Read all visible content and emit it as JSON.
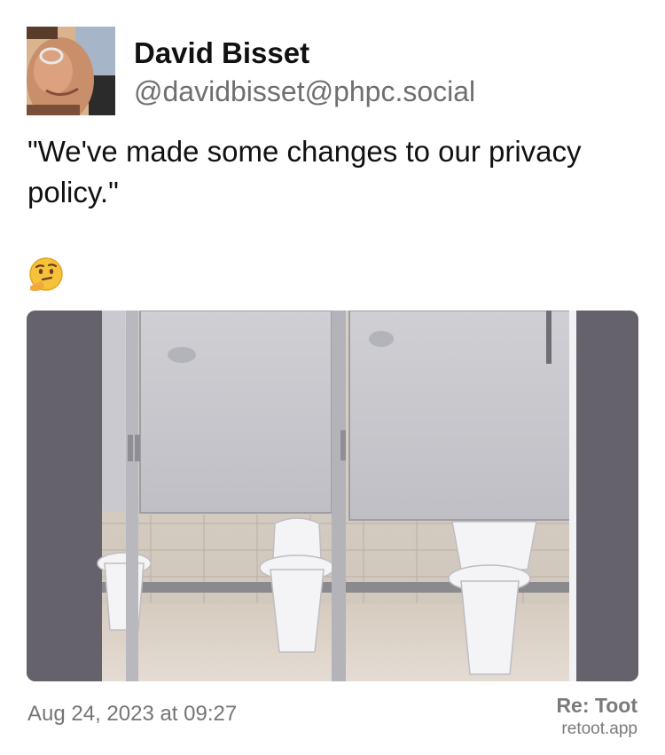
{
  "author": {
    "display_name": "David Bisset",
    "handle": "@davidbisset@phpc.social",
    "avatar_icon": "profile-photo"
  },
  "post": {
    "text": "\"We've made some changes to our privacy policy.\"",
    "emoji": "thinking-face",
    "attachment": {
      "kind": "photo",
      "subject": "toilet-stalls-with-short-doors"
    },
    "timestamp": "Aug 24, 2023 at 09:27"
  },
  "footer": {
    "brand_name": "Re: Toot",
    "brand_url": "retoot.app"
  },
  "colors": {
    "text": "#111111",
    "muted": "#757575",
    "attachment_side": "#66626b"
  }
}
